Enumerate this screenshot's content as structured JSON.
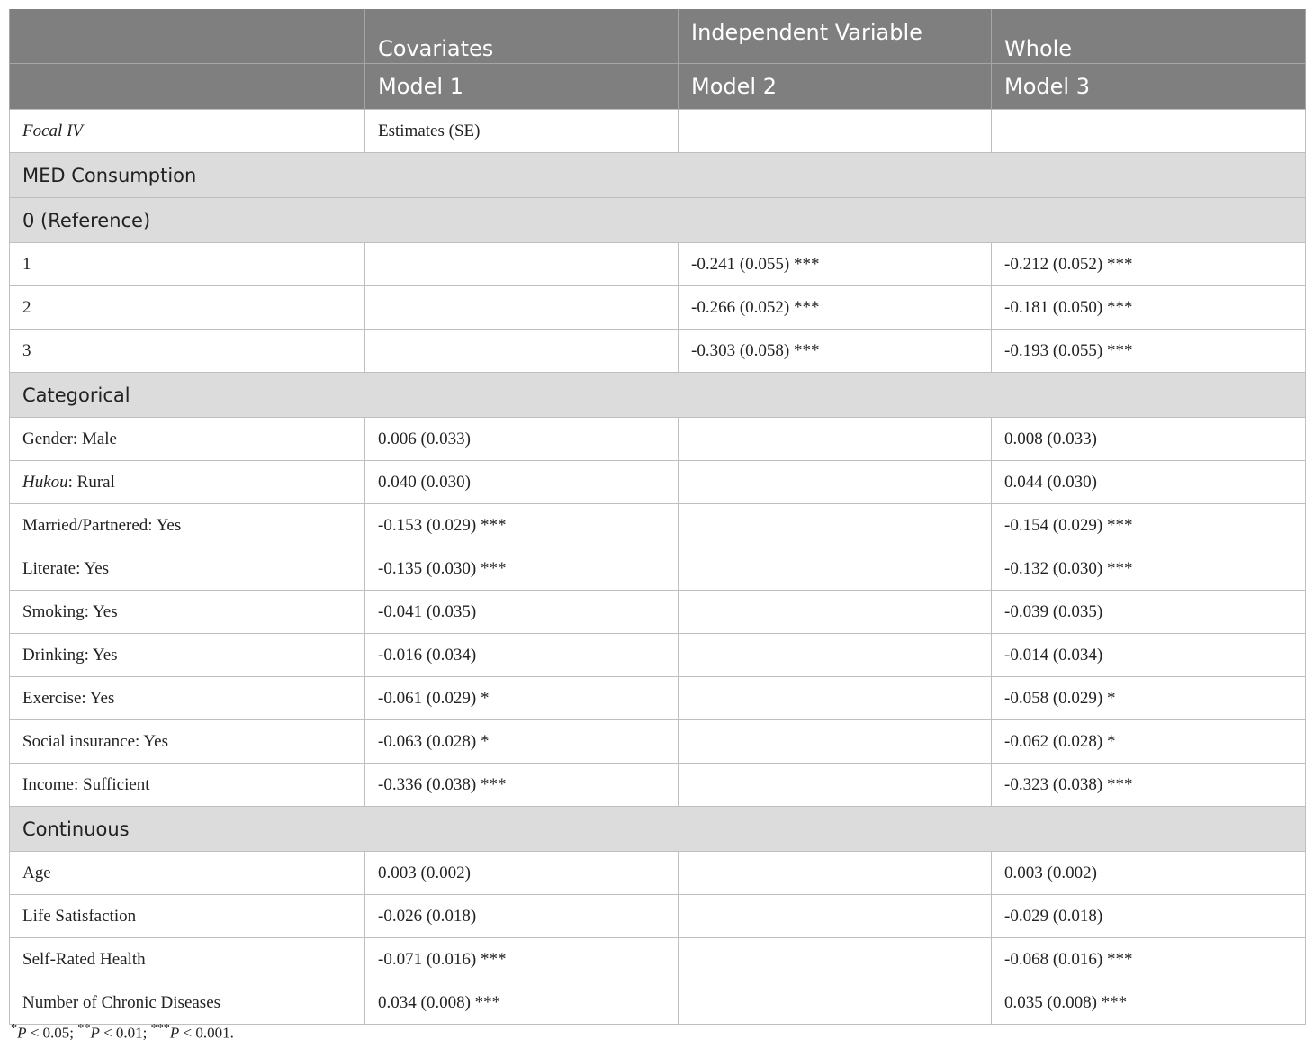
{
  "header": {
    "row1": [
      "",
      "Covariates",
      "Independent Variable",
      "Whole"
    ],
    "row2": [
      "",
      "Model 1",
      "Model 2",
      "Model 3"
    ]
  },
  "focal": {
    "label": "Focal IV",
    "col1": "Estimates (SE)",
    "col2": "",
    "col3": ""
  },
  "sections": {
    "med": "MED Consumption",
    "reference": "0 (Reference)",
    "categorical": "Categorical",
    "continuous": "Continuous"
  },
  "med_rows": [
    {
      "label": "1",
      "m1": "",
      "m2": "-0.241 (0.055) ***",
      "m3": "-0.212 (0.052) ***"
    },
    {
      "label": "2",
      "m1": "",
      "m2": "-0.266 (0.052) ***",
      "m3": "-0.181 (0.050) ***"
    },
    {
      "label": "3",
      "m1": "",
      "m2": "-0.303 (0.058) ***",
      "m3": "-0.193 (0.055) ***"
    }
  ],
  "categorical_rows": [
    {
      "label": "Gender: Male",
      "m1": "0.006 (0.033)",
      "m2": "",
      "m3": "0.008 (0.033)"
    },
    {
      "label_italic": "Hukou",
      "label_rest": ": Rural",
      "m1": "0.040 (0.030)",
      "m2": "",
      "m3": "0.044 (0.030)"
    },
    {
      "label": "Married/Partnered: Yes",
      "m1": "-0.153 (0.029) ***",
      "m2": "",
      "m3": "-0.154 (0.029) ***"
    },
    {
      "label": "Literate: Yes",
      "m1": "-0.135 (0.030) ***",
      "m2": "",
      "m3": "-0.132 (0.030) ***"
    },
    {
      "label": "Smoking: Yes",
      "m1": "-0.041 (0.035)",
      "m2": "",
      "m3": "-0.039 (0.035)"
    },
    {
      "label": "Drinking: Yes",
      "m1": "-0.016 (0.034)",
      "m2": "",
      "m3": "-0.014 (0.034)"
    },
    {
      "label": "Exercise: Yes",
      "m1": "-0.061 (0.029) *",
      "m2": "",
      "m3": "-0.058 (0.029) *"
    },
    {
      "label": "Social insurance: Yes",
      "m1": "-0.063 (0.028) *",
      "m2": "",
      "m3": "-0.062 (0.028) *"
    },
    {
      "label": "Income: Sufficient",
      "m1": "-0.336 (0.038) ***",
      "m2": "",
      "m3": "-0.323 (0.038) ***"
    }
  ],
  "continuous_rows": [
    {
      "label": "Age",
      "m1": "0.003 (0.002)",
      "m2": "",
      "m3": "0.003 (0.002)"
    },
    {
      "label": "Life Satisfaction",
      "m1": "-0.026 (0.018)",
      "m2": "",
      "m3": "-0.029 (0.018)"
    },
    {
      "label": "Self-Rated Health",
      "m1": "-0.071 (0.016) ***",
      "m2": "",
      "m3": "-0.068 (0.016) ***"
    },
    {
      "label": "Number of Chronic Diseases",
      "m1": "0.034 (0.008) ***",
      "m2": "",
      "m3": "0.035 (0.008) ***"
    }
  ],
  "footnote": {
    "p1_star": "*",
    "p1_var": "P",
    "p1_rest": " < 0.05; ",
    "p2_star": "**",
    "p2_var": "P",
    "p2_rest": " < 0.01; ",
    "p3_star": "***",
    "p3_var": "P",
    "p3_rest": " < 0.001."
  }
}
